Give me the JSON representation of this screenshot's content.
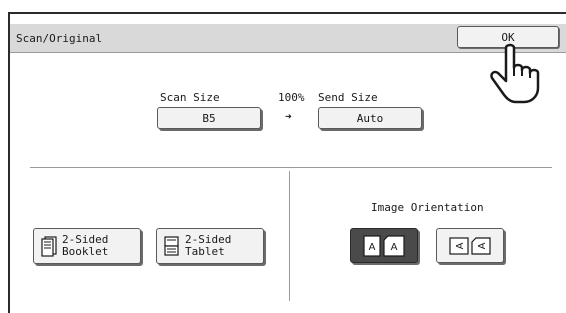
{
  "window": {
    "title": "Scan/Original"
  },
  "ok_button": {
    "label": "OK"
  },
  "scan_size": {
    "label": "Scan Size",
    "value": "B5"
  },
  "ratio": {
    "label": "100%"
  },
  "send_size": {
    "label": "Send Size",
    "value": "Auto"
  },
  "duplex": {
    "booklet": {
      "line1": "2-Sided",
      "line2": "Booklet"
    },
    "tablet": {
      "line1": "2-Sided",
      "line2": "Tablet"
    }
  },
  "image_orientation": {
    "label": "Image Orientation",
    "options": [
      {
        "name": "portrait",
        "glyph": "A",
        "selected": true
      },
      {
        "name": "landscape",
        "glyph": "A",
        "selected": false
      }
    ]
  },
  "icons": [
    "pointing-hand-icon",
    "arrow-right-icon",
    "booklet-icon",
    "tablet-icon",
    "orientation-upright-icon",
    "orientation-rotated-icon"
  ],
  "colors": {
    "titlebar": "#d9d9d9",
    "selected_button": "#4a4a4a",
    "button_face": "#f2f2f2"
  }
}
